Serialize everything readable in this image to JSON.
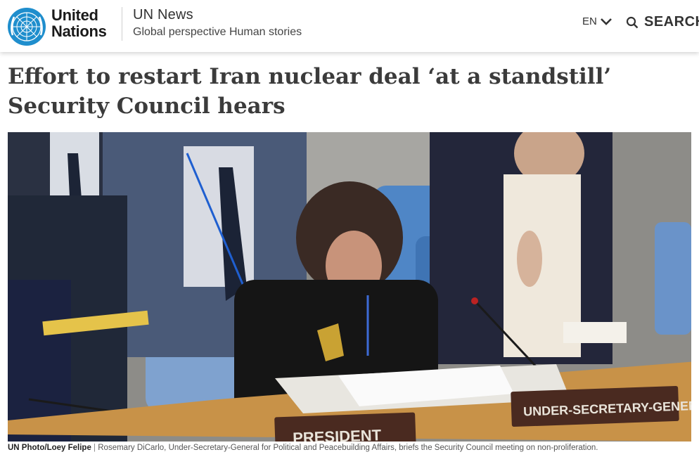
{
  "header": {
    "org_line1": "United",
    "org_line2": "Nations",
    "site_name": "UN News",
    "tagline": "Global perspective Human stories",
    "language": "EN",
    "search_label": "SEARCH"
  },
  "article": {
    "headline": "Effort to restart Iran nuclear deal ‘at a standstill’ Security Council hears",
    "photo": {
      "placards": [
        "UNDER-SECRETARY-GENERAL",
        "PRESIDENT"
      ]
    },
    "caption_credit": "UN Photo/Loey Felipe",
    "caption_separator": "|",
    "caption_text": "Rosemary DiCarlo, Under-Secretary-General for Political and Peacebuilding Affairs, briefs the Security Council meeting on non-proliferation."
  },
  "colors": {
    "un_blue": "#1f8ecd",
    "headline": "#3b3b3b",
    "placard_bg": "#4a2a20"
  }
}
